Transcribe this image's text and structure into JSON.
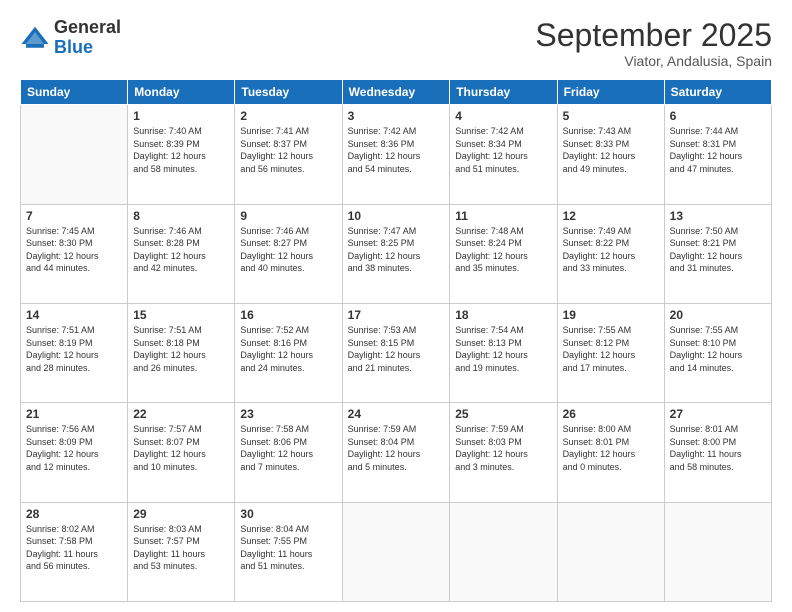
{
  "header": {
    "logo_general": "General",
    "logo_blue": "Blue",
    "month_title": "September 2025",
    "subtitle": "Viator, Andalusia, Spain"
  },
  "days_of_week": [
    "Sunday",
    "Monday",
    "Tuesday",
    "Wednesday",
    "Thursday",
    "Friday",
    "Saturday"
  ],
  "weeks": [
    [
      {
        "day": "",
        "info": ""
      },
      {
        "day": "1",
        "info": "Sunrise: 7:40 AM\nSunset: 8:39 PM\nDaylight: 12 hours\nand 58 minutes."
      },
      {
        "day": "2",
        "info": "Sunrise: 7:41 AM\nSunset: 8:37 PM\nDaylight: 12 hours\nand 56 minutes."
      },
      {
        "day": "3",
        "info": "Sunrise: 7:42 AM\nSunset: 8:36 PM\nDaylight: 12 hours\nand 54 minutes."
      },
      {
        "day": "4",
        "info": "Sunrise: 7:42 AM\nSunset: 8:34 PM\nDaylight: 12 hours\nand 51 minutes."
      },
      {
        "day": "5",
        "info": "Sunrise: 7:43 AM\nSunset: 8:33 PM\nDaylight: 12 hours\nand 49 minutes."
      },
      {
        "day": "6",
        "info": "Sunrise: 7:44 AM\nSunset: 8:31 PM\nDaylight: 12 hours\nand 47 minutes."
      }
    ],
    [
      {
        "day": "7",
        "info": "Sunrise: 7:45 AM\nSunset: 8:30 PM\nDaylight: 12 hours\nand 44 minutes."
      },
      {
        "day": "8",
        "info": "Sunrise: 7:46 AM\nSunset: 8:28 PM\nDaylight: 12 hours\nand 42 minutes."
      },
      {
        "day": "9",
        "info": "Sunrise: 7:46 AM\nSunset: 8:27 PM\nDaylight: 12 hours\nand 40 minutes."
      },
      {
        "day": "10",
        "info": "Sunrise: 7:47 AM\nSunset: 8:25 PM\nDaylight: 12 hours\nand 38 minutes."
      },
      {
        "day": "11",
        "info": "Sunrise: 7:48 AM\nSunset: 8:24 PM\nDaylight: 12 hours\nand 35 minutes."
      },
      {
        "day": "12",
        "info": "Sunrise: 7:49 AM\nSunset: 8:22 PM\nDaylight: 12 hours\nand 33 minutes."
      },
      {
        "day": "13",
        "info": "Sunrise: 7:50 AM\nSunset: 8:21 PM\nDaylight: 12 hours\nand 31 minutes."
      }
    ],
    [
      {
        "day": "14",
        "info": "Sunrise: 7:51 AM\nSunset: 8:19 PM\nDaylight: 12 hours\nand 28 minutes."
      },
      {
        "day": "15",
        "info": "Sunrise: 7:51 AM\nSunset: 8:18 PM\nDaylight: 12 hours\nand 26 minutes."
      },
      {
        "day": "16",
        "info": "Sunrise: 7:52 AM\nSunset: 8:16 PM\nDaylight: 12 hours\nand 24 minutes."
      },
      {
        "day": "17",
        "info": "Sunrise: 7:53 AM\nSunset: 8:15 PM\nDaylight: 12 hours\nand 21 minutes."
      },
      {
        "day": "18",
        "info": "Sunrise: 7:54 AM\nSunset: 8:13 PM\nDaylight: 12 hours\nand 19 minutes."
      },
      {
        "day": "19",
        "info": "Sunrise: 7:55 AM\nSunset: 8:12 PM\nDaylight: 12 hours\nand 17 minutes."
      },
      {
        "day": "20",
        "info": "Sunrise: 7:55 AM\nSunset: 8:10 PM\nDaylight: 12 hours\nand 14 minutes."
      }
    ],
    [
      {
        "day": "21",
        "info": "Sunrise: 7:56 AM\nSunset: 8:09 PM\nDaylight: 12 hours\nand 12 minutes."
      },
      {
        "day": "22",
        "info": "Sunrise: 7:57 AM\nSunset: 8:07 PM\nDaylight: 12 hours\nand 10 minutes."
      },
      {
        "day": "23",
        "info": "Sunrise: 7:58 AM\nSunset: 8:06 PM\nDaylight: 12 hours\nand 7 minutes."
      },
      {
        "day": "24",
        "info": "Sunrise: 7:59 AM\nSunset: 8:04 PM\nDaylight: 12 hours\nand 5 minutes."
      },
      {
        "day": "25",
        "info": "Sunrise: 7:59 AM\nSunset: 8:03 PM\nDaylight: 12 hours\nand 3 minutes."
      },
      {
        "day": "26",
        "info": "Sunrise: 8:00 AM\nSunset: 8:01 PM\nDaylight: 12 hours\nand 0 minutes."
      },
      {
        "day": "27",
        "info": "Sunrise: 8:01 AM\nSunset: 8:00 PM\nDaylight: 11 hours\nand 58 minutes."
      }
    ],
    [
      {
        "day": "28",
        "info": "Sunrise: 8:02 AM\nSunset: 7:58 PM\nDaylight: 11 hours\nand 56 minutes."
      },
      {
        "day": "29",
        "info": "Sunrise: 8:03 AM\nSunset: 7:57 PM\nDaylight: 11 hours\nand 53 minutes."
      },
      {
        "day": "30",
        "info": "Sunrise: 8:04 AM\nSunset: 7:55 PM\nDaylight: 11 hours\nand 51 minutes."
      },
      {
        "day": "",
        "info": ""
      },
      {
        "day": "",
        "info": ""
      },
      {
        "day": "",
        "info": ""
      },
      {
        "day": "",
        "info": ""
      }
    ]
  ]
}
